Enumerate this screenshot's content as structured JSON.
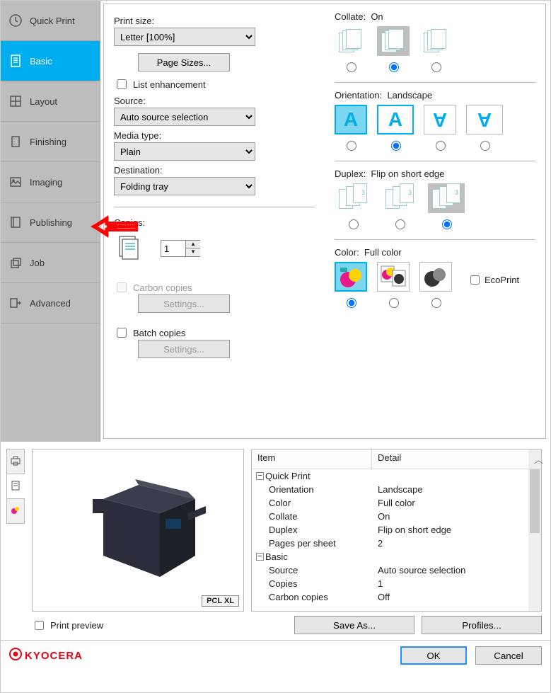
{
  "sidebar": {
    "items": [
      {
        "label": "Quick Print"
      },
      {
        "label": "Basic"
      },
      {
        "label": "Layout"
      },
      {
        "label": "Finishing"
      },
      {
        "label": "Imaging"
      },
      {
        "label": "Publishing"
      },
      {
        "label": "Job"
      },
      {
        "label": "Advanced"
      }
    ],
    "selected_index": 1
  },
  "left_col": {
    "print_size_label": "Print size:",
    "print_size_value": "Letter  [100%]",
    "page_sizes_btn": "Page Sizes...",
    "list_enhancement_label": "List enhancement",
    "list_enhancement_checked": false,
    "source_label": "Source:",
    "source_value": "Auto source selection",
    "media_label": "Media type:",
    "media_value": "Plain",
    "destination_label": "Destination:",
    "destination_value": "Folding tray",
    "copies_label": "Copies:",
    "copies_value": "1",
    "carbon_label": "Carbon copies",
    "carbon_enabled": false,
    "carbon_settings_btn": "Settings...",
    "batch_label": "Batch copies",
    "batch_checked": false,
    "batch_settings_btn": "Settings..."
  },
  "right_col": {
    "collate_label": "Collate:",
    "collate_value": "On",
    "collate_selected": 1,
    "orientation_label": "Orientation:",
    "orientation_value": "Landscape",
    "orientation_selected": 1,
    "duplex_label": "Duplex:",
    "duplex_value": "Flip on short edge",
    "duplex_selected": 2,
    "color_label": "Color:",
    "color_value": "Full color",
    "color_selected": 0,
    "ecoprint_label": "EcoPrint",
    "ecoprint_checked": false
  },
  "preview": {
    "pcl_label": "PCL XL",
    "print_preview_label": "Print preview",
    "print_preview_checked": false
  },
  "detail": {
    "head_item": "Item",
    "head_detail": "Detail",
    "groups": [
      {
        "name": "Quick Print",
        "rows": [
          {
            "item": "Orientation",
            "detail": "Landscape"
          },
          {
            "item": "Color",
            "detail": "Full color"
          },
          {
            "item": "Collate",
            "detail": "On"
          },
          {
            "item": "Duplex",
            "detail": "Flip on short edge"
          },
          {
            "item": "Pages per sheet",
            "detail": "2"
          }
        ]
      },
      {
        "name": "Basic",
        "rows": [
          {
            "item": "Source",
            "detail": "Auto source selection"
          },
          {
            "item": "Copies",
            "detail": "1"
          },
          {
            "item": "Carbon copies",
            "detail": "Off"
          }
        ]
      }
    ]
  },
  "bottom_buttons": {
    "save_as": "Save As...",
    "profiles": "Profiles..."
  },
  "footer": {
    "brand": "KYOCERA",
    "ok": "OK",
    "cancel": "Cancel"
  },
  "annotation": {
    "arrow_points_to": "Publishing"
  }
}
